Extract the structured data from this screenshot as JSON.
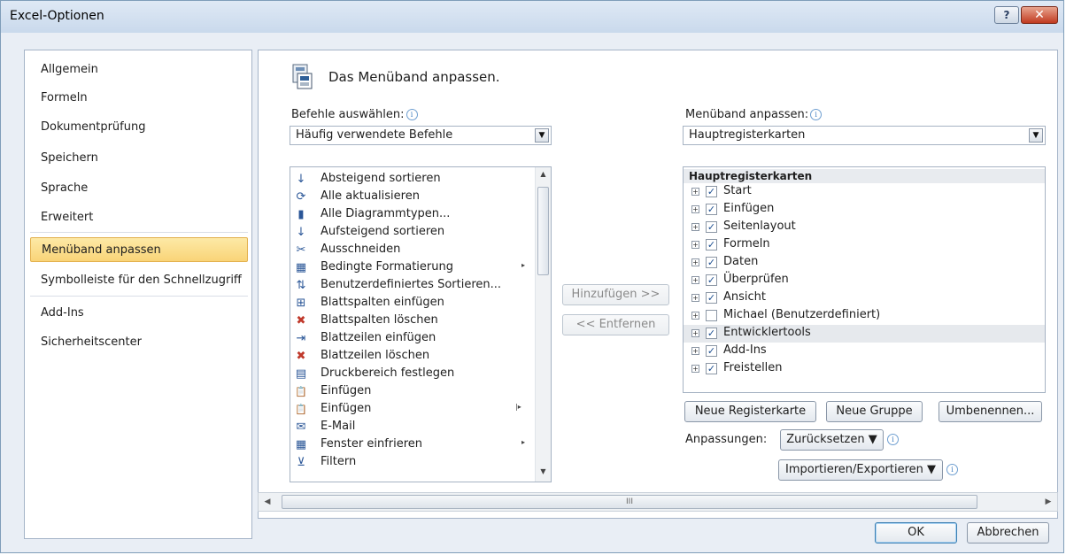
{
  "window": {
    "title": "Excel-Optionen",
    "help_glyph": "?",
    "close_glyph": "✕"
  },
  "sidebar": {
    "items": [
      {
        "label": "Allgemein"
      },
      {
        "label": "Formeln"
      },
      {
        "label": "Dokumentprüfung"
      },
      {
        "label": "Speichern"
      },
      {
        "label": "Sprache"
      },
      {
        "label": "Erweitert"
      },
      {
        "label": "Menüband anpassen",
        "selected": true
      },
      {
        "label": "Symbolleiste für den Schnellzugriff"
      },
      {
        "label": "Add-Ins"
      },
      {
        "label": "Sicherheitscenter"
      }
    ]
  },
  "main": {
    "heading": "Das Menüband anpassen.",
    "commands_label": "Befehle auswählen:",
    "commands_dropdown": "Häufig verwendete Befehle",
    "ribbon_label": "Menüband anpassen:",
    "ribbon_dropdown": "Hauptregisterkarten",
    "commands": [
      {
        "label": "Absteigend sortieren",
        "icon": "sort-descending-icon",
        "glyph": "↓"
      },
      {
        "label": "Alle aktualisieren",
        "icon": "refresh-all-icon",
        "glyph": "⟳"
      },
      {
        "label": "Alle Diagrammtypen...",
        "icon": "chart-types-icon",
        "glyph": "▮"
      },
      {
        "label": "Aufsteigend sortieren",
        "icon": "sort-ascending-icon",
        "glyph": "↓"
      },
      {
        "label": "Ausschneiden",
        "icon": "cut-icon",
        "glyph": "✂"
      },
      {
        "label": "Bedingte Formatierung",
        "icon": "conditional-formatting-icon",
        "glyph": "▦",
        "submenu": "▸"
      },
      {
        "label": "Benutzerdefiniertes Sortieren...",
        "icon": "custom-sort-icon",
        "glyph": "⇅"
      },
      {
        "label": "Blattspalten einfügen",
        "icon": "insert-columns-icon",
        "glyph": "⊞"
      },
      {
        "label": "Blattspalten löschen",
        "icon": "delete-columns-icon",
        "glyph": "✖"
      },
      {
        "label": "Blattzeilen einfügen",
        "icon": "insert-rows-icon",
        "glyph": "⇥"
      },
      {
        "label": "Blattzeilen löschen",
        "icon": "delete-rows-icon",
        "glyph": "✖"
      },
      {
        "label": "Druckbereich festlegen",
        "icon": "print-area-icon",
        "glyph": "▤"
      },
      {
        "label": "Einfügen",
        "icon": "paste-icon",
        "glyph": "📋"
      },
      {
        "label": "Einfügen",
        "icon": "paste-options-icon",
        "glyph": "📋",
        "submenu": "|▸"
      },
      {
        "label": "E-Mail",
        "icon": "email-icon",
        "glyph": "✉"
      },
      {
        "label": "Fenster einfrieren",
        "icon": "freeze-panes-icon",
        "glyph": "▦",
        "submenu": "▸"
      },
      {
        "label": "Filtern",
        "icon": "filter-icon",
        "glyph": "⊻"
      }
    ],
    "add_button": "Hinzufügen >>",
    "remove_button": "<< Entfernen",
    "tree_header": "Hauptregisterkarten",
    "tabs": [
      {
        "label": "Start",
        "checked": true
      },
      {
        "label": "Einfügen",
        "checked": true
      },
      {
        "label": "Seitenlayout",
        "checked": true
      },
      {
        "label": "Formeln",
        "checked": true
      },
      {
        "label": "Daten",
        "checked": true
      },
      {
        "label": "Überprüfen",
        "checked": true
      },
      {
        "label": "Ansicht",
        "checked": true
      },
      {
        "label": "Michael (Benutzerdefiniert)",
        "checked": false
      },
      {
        "label": "Entwicklertools",
        "checked": true,
        "highlighted": true
      },
      {
        "label": "Add-Ins",
        "checked": true
      },
      {
        "label": "Freistellen",
        "checked": true
      }
    ],
    "new_tab_button": "Neue Registerkarte",
    "new_group_button": "Neue Gruppe",
    "rename_button": "Umbenennen...",
    "customizations_label": "Anpassungen:",
    "reset_button": "Zurücksetzen ▼",
    "import_export_button": "Importieren/Exportieren ▼",
    "hscroll_grip": "III"
  },
  "footer": {
    "ok": "OK",
    "cancel": "Abbrechen"
  }
}
